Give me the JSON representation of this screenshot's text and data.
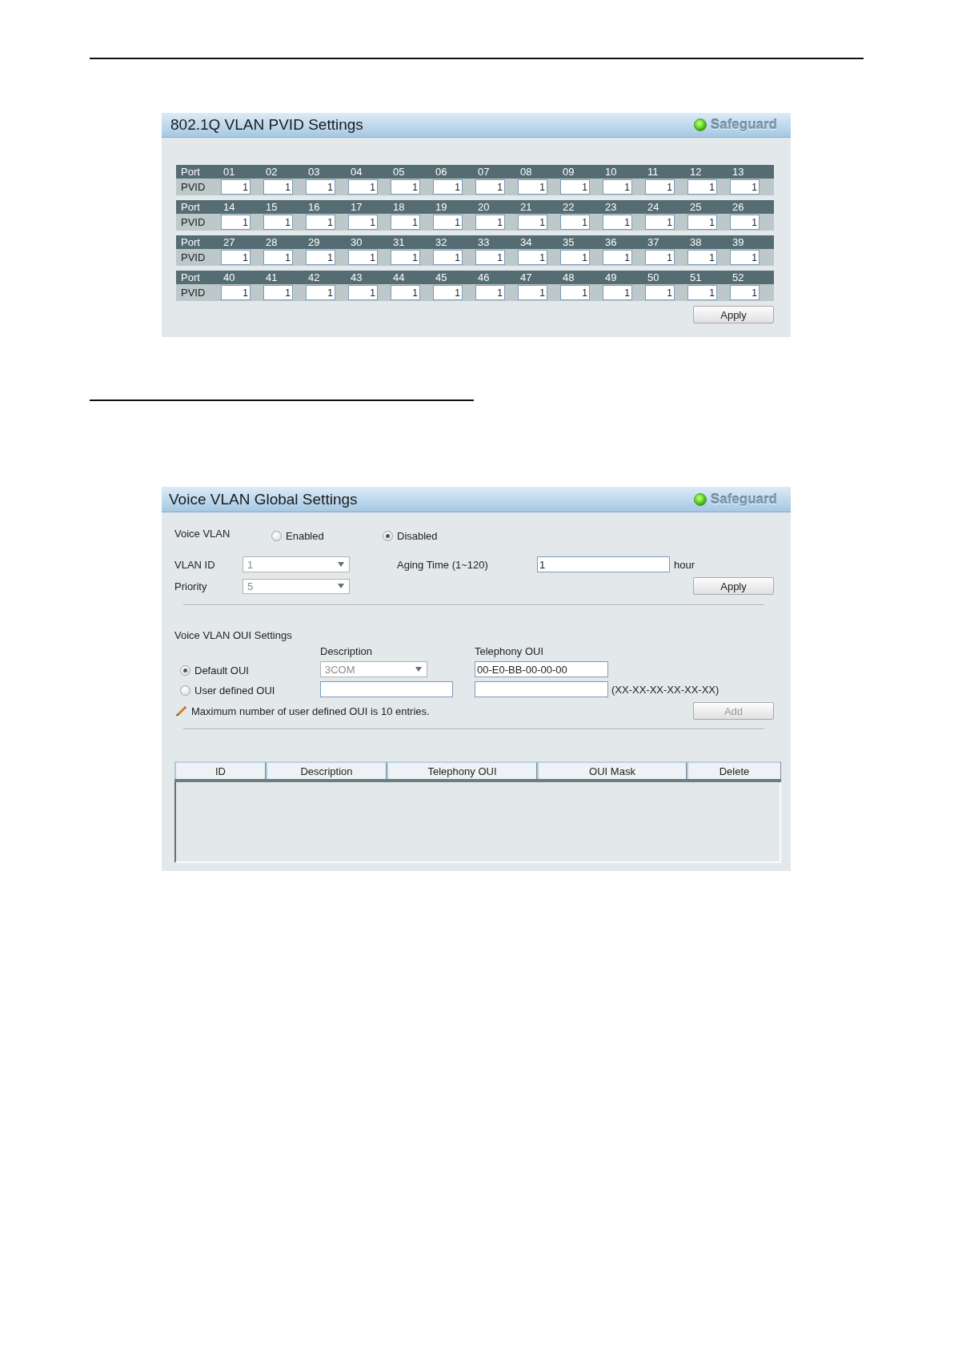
{
  "pvid_panel": {
    "title": "802.1Q VLAN PVID Settings",
    "status": "Safeguard",
    "port_groups": [
      {
        "port_label": "Port",
        "pvid_label": "PVID",
        "ports": [
          {
            "port": "01",
            "pvid": "1"
          },
          {
            "port": "02",
            "pvid": "1"
          },
          {
            "port": "03",
            "pvid": "1"
          },
          {
            "port": "04",
            "pvid": "1"
          },
          {
            "port": "05",
            "pvid": "1"
          },
          {
            "port": "06",
            "pvid": "1"
          },
          {
            "port": "07",
            "pvid": "1"
          },
          {
            "port": "08",
            "pvid": "1"
          },
          {
            "port": "09",
            "pvid": "1"
          },
          {
            "port": "10",
            "pvid": "1"
          },
          {
            "port": "11",
            "pvid": "1"
          },
          {
            "port": "12",
            "pvid": "1"
          },
          {
            "port": "13",
            "pvid": "1"
          }
        ]
      },
      {
        "port_label": "Port",
        "pvid_label": "PVID",
        "ports": [
          {
            "port": "14",
            "pvid": "1"
          },
          {
            "port": "15",
            "pvid": "1"
          },
          {
            "port": "16",
            "pvid": "1"
          },
          {
            "port": "17",
            "pvid": "1"
          },
          {
            "port": "18",
            "pvid": "1"
          },
          {
            "port": "19",
            "pvid": "1"
          },
          {
            "port": "20",
            "pvid": "1"
          },
          {
            "port": "21",
            "pvid": "1"
          },
          {
            "port": "22",
            "pvid": "1"
          },
          {
            "port": "23",
            "pvid": "1"
          },
          {
            "port": "24",
            "pvid": "1"
          },
          {
            "port": "25",
            "pvid": "1"
          },
          {
            "port": "26",
            "pvid": "1"
          }
        ]
      },
      {
        "port_label": "Port",
        "pvid_label": "PVID",
        "ports": [
          {
            "port": "27",
            "pvid": "1"
          },
          {
            "port": "28",
            "pvid": "1"
          },
          {
            "port": "29",
            "pvid": "1"
          },
          {
            "port": "30",
            "pvid": "1"
          },
          {
            "port": "31",
            "pvid": "1"
          },
          {
            "port": "32",
            "pvid": "1"
          },
          {
            "port": "33",
            "pvid": "1"
          },
          {
            "port": "34",
            "pvid": "1"
          },
          {
            "port": "35",
            "pvid": "1"
          },
          {
            "port": "36",
            "pvid": "1"
          },
          {
            "port": "37",
            "pvid": "1"
          },
          {
            "port": "38",
            "pvid": "1"
          },
          {
            "port": "39",
            "pvid": "1"
          }
        ]
      },
      {
        "port_label": "Port",
        "pvid_label": "PVID",
        "ports": [
          {
            "port": "40",
            "pvid": "1"
          },
          {
            "port": "41",
            "pvid": "1"
          },
          {
            "port": "42",
            "pvid": "1"
          },
          {
            "port": "43",
            "pvid": "1"
          },
          {
            "port": "44",
            "pvid": "1"
          },
          {
            "port": "45",
            "pvid": "1"
          },
          {
            "port": "46",
            "pvid": "1"
          },
          {
            "port": "47",
            "pvid": "1"
          },
          {
            "port": "48",
            "pvid": "1"
          },
          {
            "port": "49",
            "pvid": "1"
          },
          {
            "port": "50",
            "pvid": "1"
          },
          {
            "port": "51",
            "pvid": "1"
          },
          {
            "port": "52",
            "pvid": "1"
          }
        ]
      }
    ],
    "apply_button": "Apply"
  },
  "voice_panel": {
    "title": "Voice VLAN Global Settings",
    "status": "Safeguard",
    "voice_vlan": {
      "label": "Voice VLAN",
      "options": [
        {
          "label": "Enabled",
          "selected": false
        },
        {
          "label": "Disabled",
          "selected": true
        }
      ]
    },
    "vlan_id": {
      "label": "VLAN ID",
      "value": "1",
      "disabled": true
    },
    "priority": {
      "label": "Priority",
      "value": "5",
      "disabled": true
    },
    "aging_time": {
      "label": "Aging Time (1~120)",
      "value": "1",
      "unit": "hour"
    },
    "apply_button": "Apply",
    "oui_settings": {
      "title": "Voice VLAN OUI Settings",
      "column_headers": [
        "Description",
        "Telephony OUI"
      ],
      "rows": [
        {
          "kind": "preset",
          "label": "Default OUI",
          "selected": true,
          "description": {
            "value": "3COM",
            "disabled": true
          },
          "telephony_oui": {
            "value": "00-E0-BB-00-00-00"
          }
        },
        {
          "kind": "custom",
          "label": "User defined OUI",
          "selected": false,
          "format": "(XX-XX-XX-XX-XX-XX)"
        }
      ],
      "note": "Maximum number of user defined OUI is 10 entries.",
      "add_button": {
        "label": "Add",
        "disabled": true
      }
    },
    "oui_table": {
      "columns": [
        "ID",
        "Description",
        "Telephony OUI",
        "OUI Mask",
        "Delete"
      ]
    }
  }
}
